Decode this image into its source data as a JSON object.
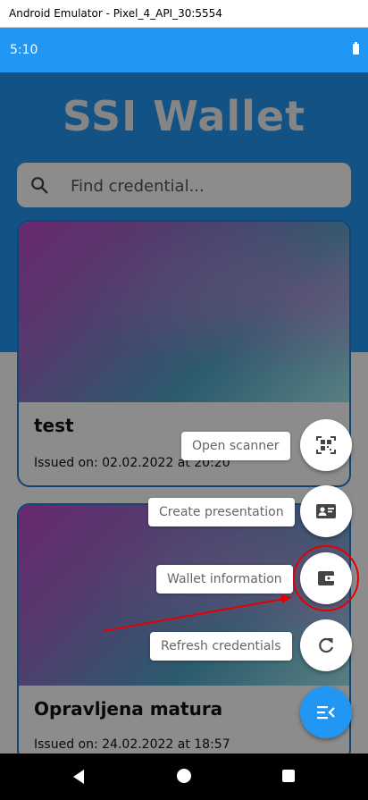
{
  "window": {
    "title": "Android Emulator - Pixel_4_API_30:5554"
  },
  "status_bar": {
    "time": "5:10"
  },
  "app": {
    "title": "SSI Wallet"
  },
  "search": {
    "placeholder": "Find credential..."
  },
  "credentials": [
    {
      "title": "test",
      "issued": "Issued on: 02.02.2022 at 20:20"
    },
    {
      "title": "Opravljena matura",
      "issued": "Issued on: 24.02.2022 at 18:57"
    }
  ],
  "fab_menu": {
    "open_scanner": "Open scanner",
    "create_presentation": "Create presentation",
    "wallet_information": "Wallet information",
    "refresh_credentials": "Refresh credentials"
  },
  "colors": {
    "primary": "#2196f3",
    "card_border": "#1e7fd6",
    "annotation": "#e50000"
  },
  "icons": {
    "search": "search-icon",
    "scanner": "qr-code-scanner-icon",
    "presentation": "contact-card-icon",
    "wallet": "wallet-icon",
    "refresh": "refresh-icon",
    "menu": "menu-open-icon"
  }
}
